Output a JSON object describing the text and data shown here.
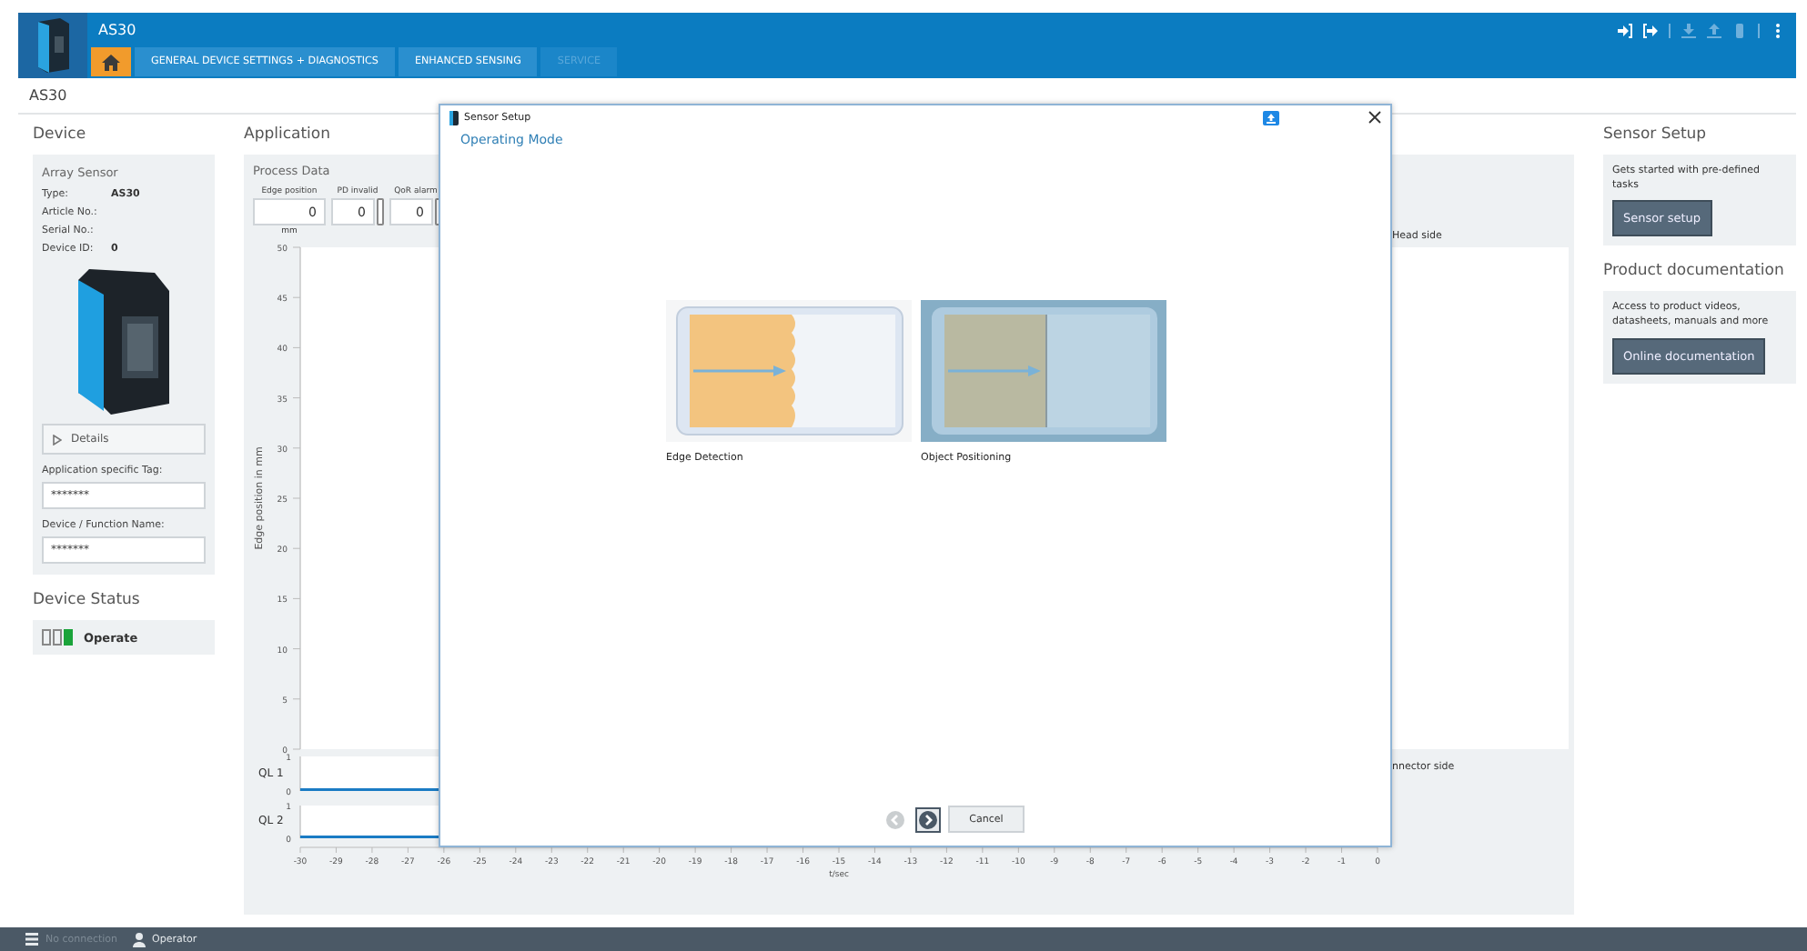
{
  "header": {
    "title": "AS30",
    "tabs": [
      {
        "kind": "home",
        "selected": true,
        "disabled": false
      },
      {
        "kind": "text",
        "label": "GENERAL DEVICE SETTINGS + DIAGNOSTICS",
        "selected": false,
        "disabled": false
      },
      {
        "kind": "text",
        "label": "ENHANCED SENSING",
        "selected": false,
        "disabled": false
      },
      {
        "kind": "text",
        "label": "SERVICE",
        "selected": false,
        "disabled": true
      }
    ],
    "toolbar": [
      {
        "kind": "login",
        "disabled": false
      },
      {
        "kind": "logout",
        "disabled": false
      },
      {
        "kind": "separator"
      },
      {
        "kind": "download",
        "disabled": true
      },
      {
        "kind": "upload",
        "disabled": true
      },
      {
        "kind": "trash",
        "disabled": true
      },
      {
        "kind": "separator"
      },
      {
        "kind": "more",
        "disabled": false
      }
    ]
  },
  "breadcrumb": "AS30",
  "device": {
    "heading": "Device",
    "card_title": "Array Sensor",
    "properties": [
      {
        "label": "Type:",
        "value": "AS30"
      },
      {
        "label": "Article No.:"
      },
      {
        "label": "Serial No.:"
      },
      {
        "label": "Device ID:",
        "value": "0"
      }
    ],
    "details_label": "Details",
    "fields": [
      {
        "label": "Application specific Tag:",
        "value": "*******"
      },
      {
        "label": "Device / Function Name:",
        "value": "*******"
      }
    ]
  },
  "device_status": {
    "heading": "Device Status",
    "label": "Operate",
    "leds": [
      {
        "on": false
      },
      {
        "on": false
      },
      {
        "on": true
      }
    ]
  },
  "application": {
    "heading": "Application",
    "process_data": {
      "title": "Process Data",
      "fields": [
        {
          "kind": "numeric",
          "label": "Edge position",
          "value": "0",
          "unit": "mm"
        },
        {
          "kind": "flag",
          "label": "PD invalid",
          "value": "0"
        },
        {
          "kind": "flag",
          "label": "QoR alarm",
          "value": "0"
        }
      ]
    },
    "chart": {
      "head_label": "Head side",
      "connector_label": "nnector side",
      "ylabel": "Edge position in mm",
      "y_ticks": [
        "50",
        "45",
        "40",
        "35",
        "30",
        "25",
        "20",
        "15",
        "10",
        "5",
        "0"
      ]
    },
    "ql_charts": [
      {
        "label": "QL 1",
        "y_ticks": [
          "1",
          "0"
        ]
      },
      {
        "label": "QL 2",
        "y_ticks": [
          "1",
          "0"
        ]
      }
    ],
    "time_axis": {
      "title": "t/sec",
      "ticks": [
        "-30",
        "-29",
        "-28",
        "-27",
        "-26",
        "-25",
        "-24",
        "-23",
        "-22",
        "-21",
        "-20",
        "-19",
        "-18",
        "-17",
        "-16",
        "-15",
        "-14",
        "-13",
        "-12",
        "-11",
        "-10",
        "-9",
        "-8",
        "-7",
        "-6",
        "-5",
        "-4",
        "-3",
        "-2",
        "-1",
        "0"
      ]
    }
  },
  "sensor_setup": {
    "heading": "Sensor Setup",
    "text": "Gets started with pre-defined tasks",
    "button": "Sensor setup"
  },
  "product_documentation": {
    "heading": "Product documentation",
    "text": "Access to product videos, datasheets, manuals and more",
    "button": "Online documentation"
  },
  "dialog": {
    "title": "Sensor Setup",
    "subtitle": "Operating Mode",
    "modes": [
      {
        "kind": "edge",
        "label": "Edge Detection",
        "selected": false
      },
      {
        "kind": "object",
        "label": "Object Positioning",
        "selected": true
      }
    ],
    "back_disabled": true,
    "cancel_label": "Cancel"
  },
  "status_bar": {
    "connection": "No connection",
    "connected": false,
    "user": "Operator"
  }
}
